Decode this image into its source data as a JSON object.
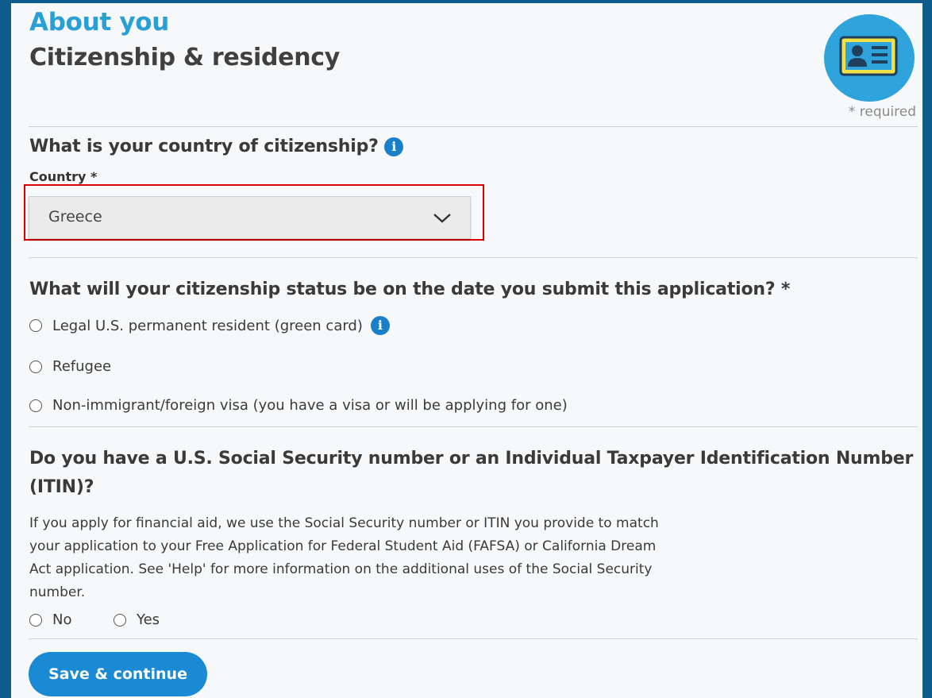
{
  "header": {
    "section": "About you",
    "title": "Citizenship & residency",
    "required_note": "* required"
  },
  "q_citizenship": {
    "question": "What is your country of citizenship?",
    "info_glyph": "i",
    "field_label": "Country *",
    "selected_value": "Greece"
  },
  "q_status": {
    "question": "What will your citizenship status be on the date you submit this application? *",
    "options": [
      {
        "label": "Legal U.S. permanent resident (green card)",
        "has_info": true
      },
      {
        "label": "Refugee"
      },
      {
        "label": "Non-immigrant/foreign visa (you have a visa or will be applying for one)"
      }
    ]
  },
  "q_ssn": {
    "question_line1": "Do you have a U.S. Social Security number or an Individual Taxpayer Identification Number",
    "question_line2": "(ITIN)?",
    "help_lines": [
      "If you apply for financial aid, we use the Social Security number or ITIN you provide to match",
      "your application to your Free Application for Federal Student Aid (FAFSA) or California Dream",
      "Act application. See 'Help' for more information on the additional uses of the Social Security",
      "number."
    ],
    "options": [
      "No",
      "Yes"
    ]
  },
  "actions": {
    "save_label": "Save & continue"
  },
  "colors": {
    "background": "#0d5c8c",
    "panel": "#f6f8fa",
    "accent": "#2a9fd6",
    "button": "#1a8ad4",
    "highlight": "#e00000"
  }
}
